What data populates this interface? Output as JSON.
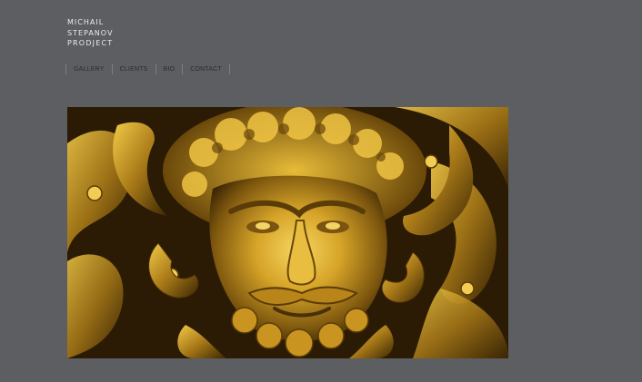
{
  "logo": {
    "line1": "Michail",
    "line2": "Stepanov",
    "line3": "prodject"
  },
  "nav": {
    "items": [
      {
        "label": "GALLERY"
      },
      {
        "label": "CLIENTS"
      },
      {
        "label": "BIO"
      },
      {
        "label": "CONTACT"
      }
    ]
  },
  "hero": {
    "icon": "gilded-satyr-mask-image",
    "colors": {
      "gold_light": "#f0c640",
      "gold_mid": "#b8861c",
      "gold_dark": "#4a3006",
      "background": "#5c5e62"
    }
  }
}
